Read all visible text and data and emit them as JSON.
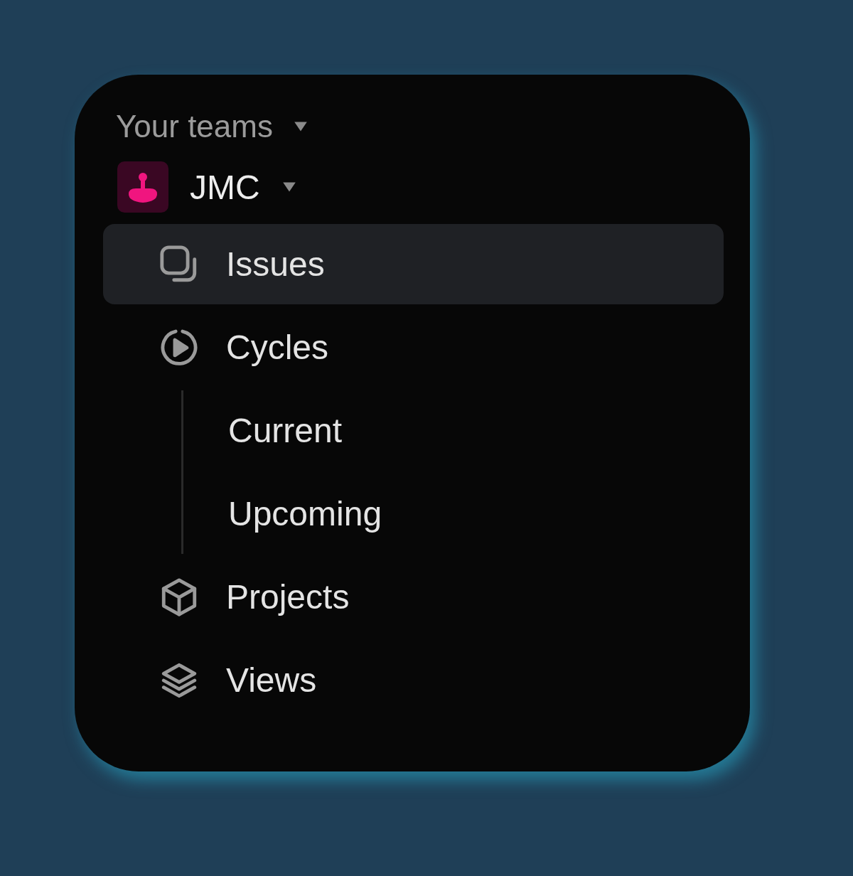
{
  "section": {
    "label": "Your teams"
  },
  "team": {
    "name": "JMC"
  },
  "nav": [
    {
      "label": "Issues",
      "kind": "issues",
      "selected": true
    },
    {
      "label": "Cycles",
      "kind": "cycles",
      "selected": false,
      "children": [
        {
          "label": "Current",
          "selected": false
        },
        {
          "label": "Upcoming",
          "selected": false
        }
      ]
    },
    {
      "label": "Projects",
      "kind": "projects",
      "selected": false
    },
    {
      "label": "Views",
      "kind": "views",
      "selected": false
    }
  ]
}
